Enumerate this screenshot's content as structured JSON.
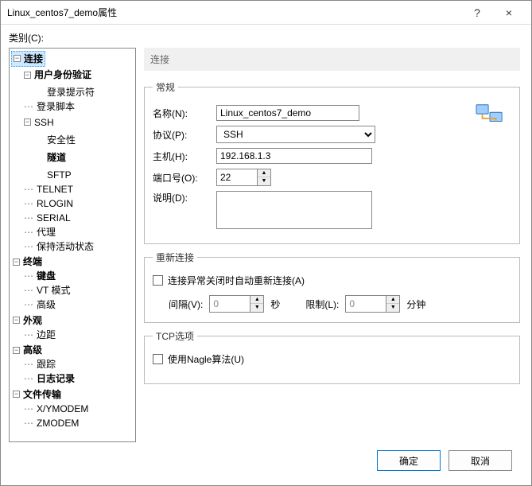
{
  "titlebar": {
    "title": "Linux_centos7_demo属性",
    "help": "?",
    "close": "×"
  },
  "category_label": "类别(C):",
  "tree": {
    "connection": "连接",
    "auth": "用户身份验证",
    "login_prompt": "登录提示符",
    "login_script": "登录脚本",
    "ssh": "SSH",
    "security": "安全性",
    "tunnel": "隧道",
    "sftp": "SFTP",
    "telnet": "TELNET",
    "rlogin": "RLOGIN",
    "serial": "SERIAL",
    "proxy": "代理",
    "keepalive": "保持活动状态",
    "terminal": "终端",
    "keyboard": "键盘",
    "vtmode": "VT 模式",
    "advanced_term": "高级",
    "appearance": "外观",
    "margin": "边距",
    "advanced": "高级",
    "trace": "跟踪",
    "log": "日志记录",
    "filetransfer": "文件传输",
    "xymodem": "X/YMODEM",
    "zmodem": "ZMODEM"
  },
  "panel": {
    "heading": "连接",
    "general": {
      "legend": "常规",
      "name_label": "名称(N):",
      "name_value": "Linux_centos7_demo",
      "protocol_label": "协议(P):",
      "protocol_value": "SSH",
      "host_label": "主机(H):",
      "host_value": "192.168.1.3",
      "port_label": "端口号(O):",
      "port_value": "22",
      "desc_label": "说明(D):",
      "desc_value": ""
    },
    "reconnect": {
      "legend": "重新连接",
      "checkbox": "连接异常关闭时自动重新连接(A)",
      "interval_label": "间隔(V):",
      "interval_value": "0",
      "seconds": "秒",
      "limit_label": "限制(L):",
      "limit_value": "0",
      "minutes": "分钟"
    },
    "tcp": {
      "legend": "TCP选项",
      "nagle": "使用Nagle算法(U)"
    }
  },
  "footer": {
    "ok": "确定",
    "cancel": "取消"
  }
}
